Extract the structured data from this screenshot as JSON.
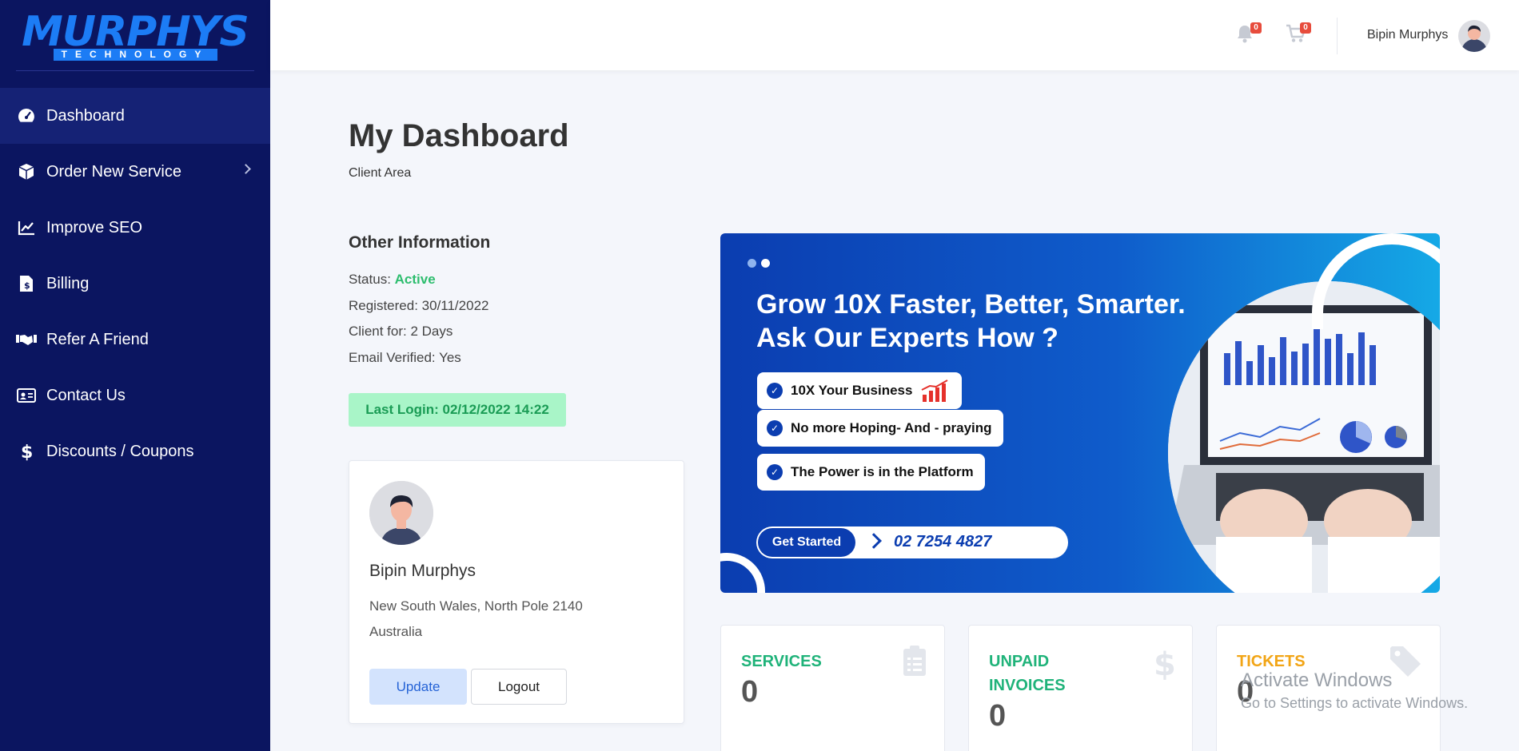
{
  "brand": {
    "logo_main": "MURPHYS",
    "logo_sub": "TECHNOLOGY",
    "accent": "#1c7cf5"
  },
  "sidebar": {
    "items": [
      {
        "label": "Dashboard",
        "icon": "gauge-icon",
        "active": true
      },
      {
        "label": "Order New Service",
        "icon": "box-icon",
        "has_submenu": true
      },
      {
        "label": "Improve SEO",
        "icon": "chart-line-icon"
      },
      {
        "label": "Billing",
        "icon": "invoice-icon"
      },
      {
        "label": "Refer A Friend",
        "icon": "handshake-icon"
      },
      {
        "label": "Contact Us",
        "icon": "contact-card-icon"
      },
      {
        "label": "Discounts / Coupons",
        "icon": "dollar-icon"
      }
    ]
  },
  "topbar": {
    "notifications_count": "0",
    "cart_count": "0",
    "user_name": "Bipin Murphys"
  },
  "page": {
    "title": "My Dashboard",
    "subtitle": "Client Area"
  },
  "info": {
    "title": "Other Information",
    "status_label": "Status:",
    "status_value": "Active",
    "registered": "Registered: 30/11/2022",
    "client_for": "Client for: 2 Days",
    "email_verified": "Email Verified: Yes",
    "last_login": "Last Login: 02/12/2022 14:22"
  },
  "profile": {
    "name": "Bipin Murphys",
    "address_line1": "New South Wales, North Pole 2140",
    "address_line2": "Australia",
    "update_label": "Update",
    "logout_label": "Logout"
  },
  "banner": {
    "headline_line1": "Grow 10X Faster, Better, Smarter.",
    "headline_line2": "Ask Our Experts How ?",
    "bullets": [
      "10X Your Business",
      "No more Hoping- And - praying",
      "The Power is in the Platform"
    ],
    "cta_label": "Get Started",
    "phone": "02 7254 4827"
  },
  "stats": [
    {
      "label_line1": "SERVICES",
      "label_line2": "",
      "value": "0",
      "color": "#20b37a",
      "icon": "clipboard-icon"
    },
    {
      "label_line1": "UNPAID",
      "label_line2": "INVOICES",
      "value": "0",
      "color": "#20b37a",
      "icon": "dollar-icon"
    },
    {
      "label_line1": "TICKETS",
      "label_line2": "",
      "value": "0",
      "color": "#f2a516",
      "icon": "tag-icon"
    }
  ],
  "watermark": {
    "line1": "Activate Windows",
    "line2": "Go to Settings to activate Windows."
  }
}
